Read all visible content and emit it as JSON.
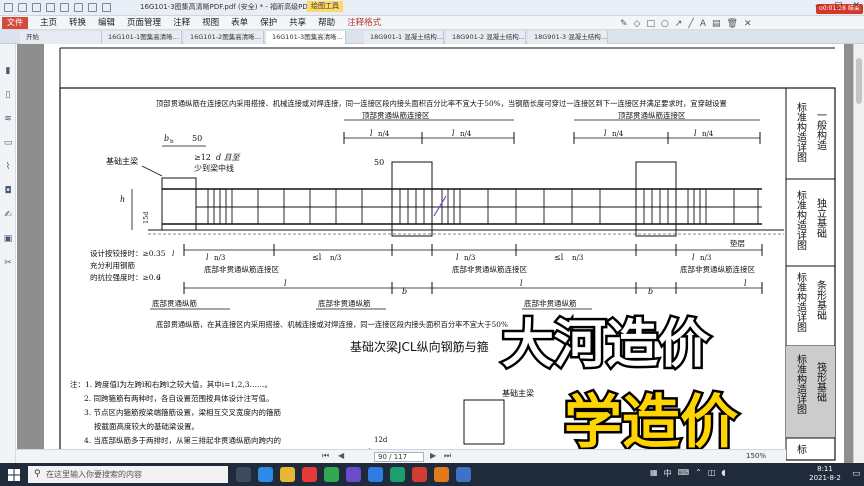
{
  "window": {
    "title": "16G101-3图集高清晰PDF.pdf (安全) * - 福昕高级PDF编辑器",
    "tool_badge": "绘图工具",
    "timer": "00:01:28 结束",
    "controls": {
      "minimize": "—",
      "maximize": "□",
      "close": "✕"
    }
  },
  "menu": {
    "file": "文件",
    "items": [
      "主页",
      "转换",
      "编辑",
      "页面管理",
      "注释",
      "视图",
      "表单",
      "保护",
      "共享",
      "帮助",
      "注释格式"
    ]
  },
  "tabs": [
    {
      "label": "开始",
      "active": false
    },
    {
      "label": "16G101-1图集高清晰...",
      "active": false
    },
    {
      "label": "16G101-2图集高清晰...",
      "active": false
    },
    {
      "label": "16G101-3图集高清晰...",
      "active": true
    },
    {
      "label": "18G901-1 混凝土结构...",
      "active": false
    },
    {
      "label": "18G901-2 混凝土结构...",
      "active": false
    },
    {
      "label": "18G901-3 混凝土结构...",
      "active": false
    }
  ],
  "sidebar_icons": [
    "bookmark-icon",
    "pages-icon",
    "layers-icon",
    "comments-icon",
    "attachments-icon",
    "security-icon",
    "signature-icon",
    "fields-icon",
    "tools-icon"
  ],
  "drawing": {
    "top_note": "顶部贯通纵筋在连接区内采用搭接、机械连接或对焊连接，同一连接区段内接头面积百分比率不宜大于50%，当钢筋长度可穿过一连接区到下一连接区并满足要求时，宜穿越设置",
    "zone_label": "顶部贯通纵筋连接区",
    "bb": "b",
    "bb_sub": "b",
    "fifty": "50",
    "ln4": "l",
    "ln4_suffix": "n/4",
    "main_beam": "基础主梁",
    "main_beam_2": "基础主梁",
    "twelve_d_1": "≥12",
    "twelve_d_2": "d 且至",
    "twelve_d_3": "少到梁中线",
    "hb": "h",
    "fifteen_d": "15d",
    "design_hinge_1": "设计按铰接时：≥0.35",
    "design_hinge_2": "充分利用钢筋",
    "design_hinge_3": "的抗拉强度时：≥0.6",
    "lab": "l",
    "ln3": "l",
    "ln3_suffix": "n/3",
    "le_ln3": "≤l",
    "bottom_zone": "底部非贯通纵筋连接区",
    "bottom_nonthrough": "底部非贯通纵筋",
    "bottom_through": "底部贯通纵筋",
    "bottom_note": "底部贯通纵筋，在其连接区内采用搭接、机械连接或对焊连接，同一连接区段内接头面积百分率不宜大于50%",
    "l1": "l",
    "l2": "l",
    "l3": "l",
    "cushion": "垫层",
    "figure_title": "基础次梁JCL纵向钢筋与箍",
    "notes": [
      "注：1. 跨度值l为左跨l和右跨l之较大值，其中i=1,2,3……。",
      "2. 同跨箍筋有两种时，各自设置范围按具体设计注写值。",
      "3. 节点区内箍筋按梁端箍筋设置，梁相互交叉宽度内的箍筋",
      "按截面高度较大的基础梁设置。",
      "4. 当底部纵筋多于两排时，从第三排起非贯通纵筋向跨内的"
    ],
    "d12": "12d",
    "hb2": "h"
  },
  "right_index": [
    {
      "col1": "标准构造详图",
      "col2": "一般构造"
    },
    {
      "col1": "标准构造详图",
      "col2": "独立基础"
    },
    {
      "col1": "标准构造详图",
      "col2": "条形基础"
    },
    {
      "col1": "标准构造详图",
      "col2": "筏形基础"
    },
    {
      "col1": "标",
      "col2": ""
    }
  ],
  "watermark": {
    "line1": "大河造价",
    "line2": "学造价"
  },
  "status": {
    "page": "90 / 117",
    "zoom": "150%"
  },
  "taskbar": {
    "search_placeholder": "在这里输入你要搜索的内容",
    "ime": "中",
    "time": "8:11",
    "date": "2021-8-2"
  },
  "colors": {
    "file_button": "#d34b3b",
    "titlebar": "#e9eef6",
    "viewer_bg": "#8e8e8e",
    "watermark_fill": "#ffd400",
    "watermark_stroke": "#000000",
    "taskbar": "#1f2b3a",
    "timer_badge": "#d8362a"
  }
}
